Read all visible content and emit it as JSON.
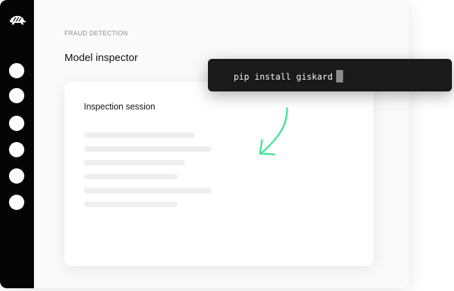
{
  "sidebar": {
    "logo_icon": "turtle-logo-icon",
    "nav_items": [
      {
        "icon": "nav-dot-icon"
      },
      {
        "icon": "nav-dot-icon"
      },
      {
        "icon": "nav-dot-icon"
      },
      {
        "icon": "nav-dot-icon"
      },
      {
        "icon": "nav-dot-icon"
      },
      {
        "icon": "nav-dot-icon"
      }
    ]
  },
  "main": {
    "breadcrumb": "FRAUD DETECTION",
    "title": "Model inspector",
    "card": {
      "title": "Inspection session"
    }
  },
  "terminal": {
    "command": "pip install giskard"
  },
  "colors": {
    "sidebar": "#050505",
    "terminal_bg": "#1a1a1a",
    "arrow": "#4be39a",
    "skeleton": "#eeeeee"
  }
}
